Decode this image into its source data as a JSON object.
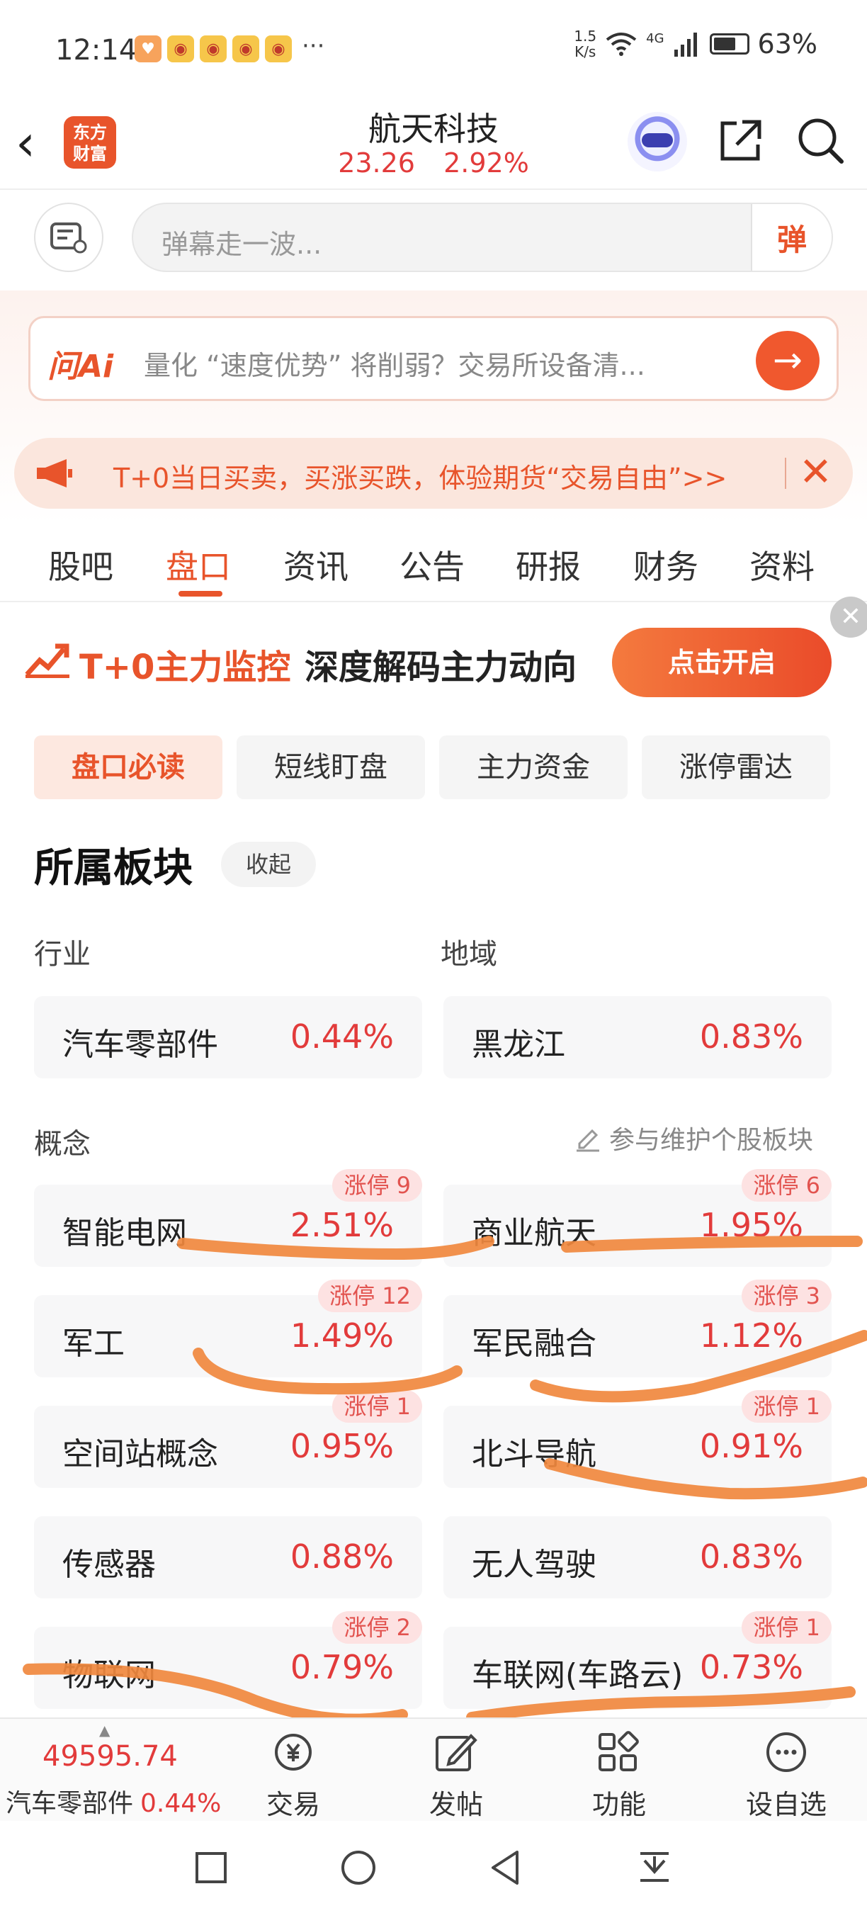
{
  "status_bar": {
    "time": "12:14",
    "more": "···",
    "net_speed_value": "1.5",
    "net_speed_unit": "K/s",
    "network": "4G",
    "battery": "63%"
  },
  "header": {
    "logo_line1": "东方",
    "logo_line2": "财富",
    "stock_name": "航天科技",
    "price": "23.26",
    "change_pct": "2.92%"
  },
  "danmaku": {
    "placeholder": "弹幕走一波...",
    "send_label": "弹"
  },
  "ai": {
    "label": "问Ai",
    "text": "量化 “速度优势” 将削弱？交易所设备清..."
  },
  "promo": {
    "text": "T+0当日买卖，买涨买跌，体验期货“交易自由”>>"
  },
  "tabs": [
    "股吧",
    "盘口",
    "资讯",
    "公告",
    "研报",
    "财务",
    "资料"
  ],
  "monitor": {
    "title": "T+0主力监控",
    "subtitle": "深度解码主力动向",
    "button": "点击开启"
  },
  "subtabs": [
    "盘口必读",
    "短线盯盘",
    "主力资金",
    "涨停雷达"
  ],
  "sectors": {
    "title": "所属板块",
    "collapse": "收起",
    "industry_label": "行业",
    "region_label": "地域",
    "concept_label": "概念",
    "maintain_label": "参与维护个股板块",
    "industry": {
      "name": "汽车零部件",
      "pct": "0.44%"
    },
    "region": {
      "name": "黑龙江",
      "pct": "0.83%"
    },
    "concepts": [
      {
        "name": "智能电网",
        "pct": "2.51%",
        "badge": "涨停 9"
      },
      {
        "name": "商业航天",
        "pct": "1.95%",
        "badge": "涨停 6"
      },
      {
        "name": "军工",
        "pct": "1.49%",
        "badge": "涨停 12"
      },
      {
        "name": "军民融合",
        "pct": "1.12%",
        "badge": "涨停 3"
      },
      {
        "name": "空间站概念",
        "pct": "0.95%",
        "badge": "涨停 1"
      },
      {
        "name": "北斗导航",
        "pct": "0.91%",
        "badge": "涨停 1"
      },
      {
        "name": "传感器",
        "pct": "0.88%",
        "badge": ""
      },
      {
        "name": "无人驾驶",
        "pct": "0.83%",
        "badge": ""
      },
      {
        "name": "物联网",
        "pct": "0.79%",
        "badge": "涨停 2"
      },
      {
        "name": "车联网(车路云)",
        "pct": "0.73%",
        "badge": "涨停 1"
      }
    ]
  },
  "bottom": {
    "index_value": "49595.74",
    "index_name": "汽车零部件",
    "index_pct": "0.44%",
    "items": [
      "交易",
      "发帖",
      "功能",
      "设自选"
    ]
  },
  "colors": {
    "accent": "#e8542b",
    "up_red": "#e23b3b",
    "scribble": "#f0883e"
  }
}
